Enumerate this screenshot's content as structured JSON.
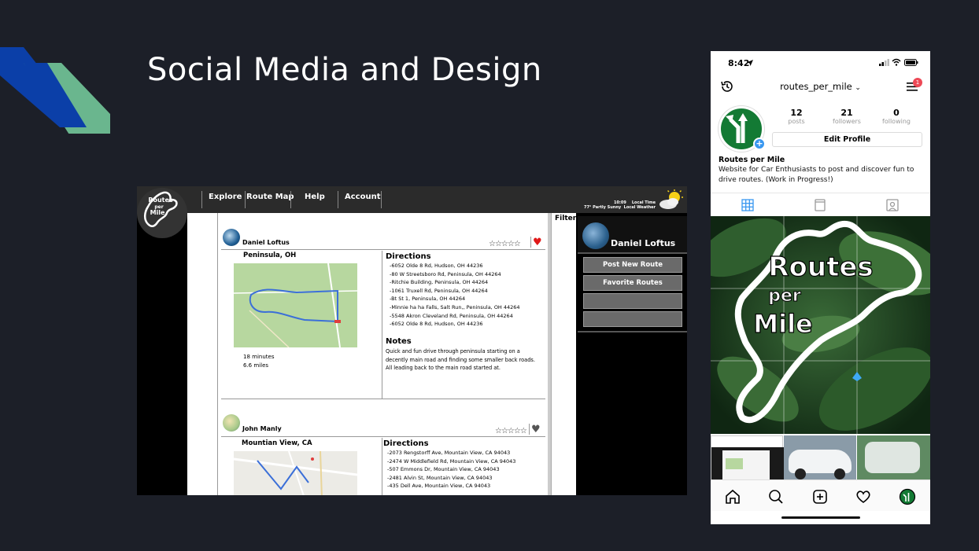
{
  "slide": {
    "title": "Social Media and Design",
    "accent_blue": "#0b3fa8",
    "accent_green": "#6fbf94"
  },
  "website": {
    "logo_text": [
      "Routes",
      "per",
      "Mile"
    ],
    "nav": [
      "Explore",
      "Route Map",
      "Help",
      "Account"
    ],
    "weather": {
      "line1_time": "10:09",
      "line1_label": "Local Time",
      "line2_temp": "77° Partly Sunny",
      "line2_label": "Local Weather"
    },
    "filter_label": "Filter",
    "sidebar": {
      "user_name": "Daniel Loftus",
      "buttons": [
        "Post New Route",
        "Favorite Routes",
        "",
        ""
      ]
    },
    "posts": [
      {
        "author": "Daniel Loftus",
        "location": "Peninsula, OH",
        "duration": "18 minutes",
        "distance": "6.6 miles",
        "rating": "☆☆☆☆☆",
        "favorited": true,
        "directions_title": "Directions",
        "directions": [
          "-6052 Olde 8 Rd, Hudson, OH 44236",
          "-80 W Streetsboro Rd, Peninsula, OH 44264",
          "-Ritchie Building, Peninsula, OH 44264",
          "-1061 Truxell Rd, Peninsula, OH 44264",
          "-Bt St 1, Peninsula, OH 44264",
          "-Minnie ha ha Falls, Salt Run,, Peninsula, OH 44264",
          "-5548 Akron Cleveland Rd, Peninsula, OH 44264",
          "-6052 Olde 8 Rd, Hudson, OH 44236"
        ],
        "notes_title": "Notes",
        "notes": "Quick and fun drive through peninsula starting on a decently main road and finding some smaller back roads. All leading back to the main road started at."
      },
      {
        "author": "John Manly",
        "location": "Mountian View, CA",
        "rating": "☆☆☆☆☆",
        "favorited": false,
        "directions_title": "Directions",
        "directions": [
          "-2073 Rengstorff Ave, Mountain View, CA 94043",
          "-2474 W Middlefield Rd, Mountain View, CA 94043",
          "-507 Emmons Dr, Mountain View, CA 94043",
          "-2481 Alvin St, Mountain View, CA 94043",
          "-435 Dell Ave, Mountain View, CA 94043"
        ]
      }
    ]
  },
  "phone": {
    "time": "8:42",
    "username": "routes_per_mile",
    "notification_count": "1",
    "stats": [
      {
        "num": "12",
        "label": "posts"
      },
      {
        "num": "21",
        "label": "followers"
      },
      {
        "num": "0",
        "label": "following"
      }
    ],
    "edit_profile": "Edit Profile",
    "display_name": "Routes per Mile",
    "bio": "Website for Car Enthusiasts to post and discover fun to drive routes. (Work in Progress!)",
    "featured_post_text": [
      "Routes",
      "per",
      "Mile"
    ],
    "icons": {
      "history": "history-icon",
      "menu": "menu-icon",
      "grid": "grid-icon",
      "igtv": "igtv-icon",
      "tagged": "tagged-icon",
      "home": "home-icon",
      "search": "search-icon",
      "add": "add-icon",
      "activity": "heart-icon",
      "profile": "profile-icon"
    },
    "brand_green": "#137a34",
    "link_blue": "#3897f0"
  }
}
